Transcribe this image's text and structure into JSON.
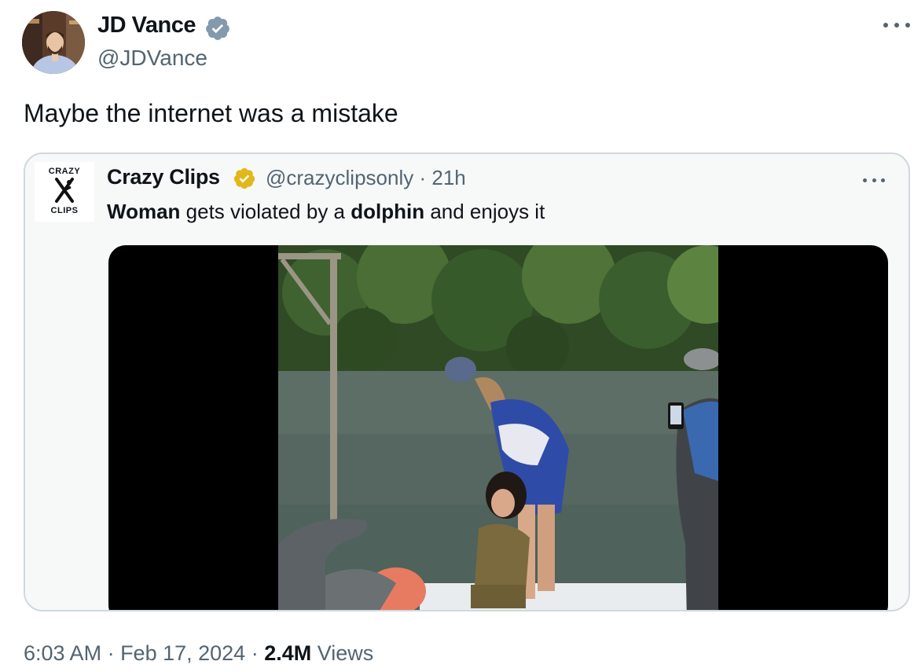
{
  "author": {
    "name": "JD Vance",
    "handle": "@JDVance",
    "verified_badge_color": "#829aab"
  },
  "tweet": {
    "text": "Maybe the internet was a mistake"
  },
  "quoted": {
    "avatar_top_text": "CRAZY",
    "avatar_bottom_text": "CLIPS",
    "name": "Crazy Clips",
    "handle": "@crazyclipsonly",
    "separator": "·",
    "time": "21h",
    "verified_badge_color": "#e2b719",
    "text_parts": [
      "Woman",
      " gets violated by a ",
      "dolphin",
      " and enjoys it"
    ]
  },
  "footer": {
    "time": "6:03 AM",
    "sep1": " · ",
    "date": "Feb 17, 2024",
    "sep2": " · ",
    "views_count": "2.4M",
    "views_label": " Views"
  },
  "icons": {
    "more": "more-horizontal-icon",
    "verified": "verified-badge-icon"
  }
}
